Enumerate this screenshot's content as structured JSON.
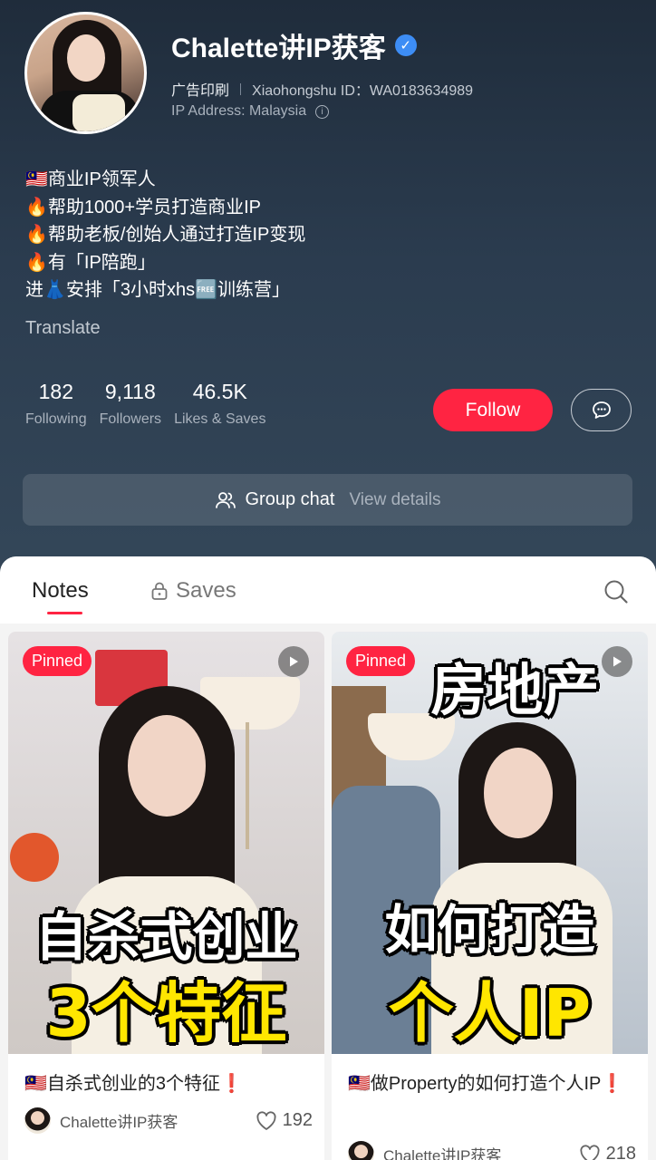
{
  "profile": {
    "name": "Chalette讲IP获客",
    "category": "广告印刷",
    "id_label": "Xiaohongshu ID：WA0183634989",
    "ip_address": "IP Address: Malaysia",
    "bio": [
      "🇲🇾商业IP领军人",
      "🔥帮助1000+学员打造商业IP",
      "🔥帮助老板/创始人通过打造IP变现",
      "🔥有「IP陪跑」",
      "进👗安排「3小时xhs🆓训练营」"
    ],
    "translate": "Translate"
  },
  "stats": [
    {
      "value": "182",
      "label": "Following"
    },
    {
      "value": "9,118",
      "label": "Followers"
    },
    {
      "value": "46.5K",
      "label": "Likes & Saves"
    }
  ],
  "actions": {
    "follow": "Follow"
  },
  "group_chat": {
    "label": "Group chat",
    "link": "View details"
  },
  "tabs": {
    "notes": "Notes",
    "saves": "Saves"
  },
  "notes": [
    {
      "badge": "Pinned",
      "overlay_line1": "自杀式创业",
      "overlay_line2": "3个特征",
      "title": "🇲🇾自杀式创业的3个特征❗",
      "author": "Chalette讲IP获客",
      "likes": "192"
    },
    {
      "badge": "Pinned",
      "overlay_top": "房地产",
      "overlay_line1": "如何打造",
      "overlay_line2": "个人IP",
      "title": "🇲🇾做Property的如何打造个人IP❗",
      "author": "Chalette讲IP获客",
      "likes": "218"
    }
  ],
  "colors": {
    "accent": "#ff2442",
    "header_bg": "#2b3c4f",
    "verified": "#3d8df5"
  }
}
